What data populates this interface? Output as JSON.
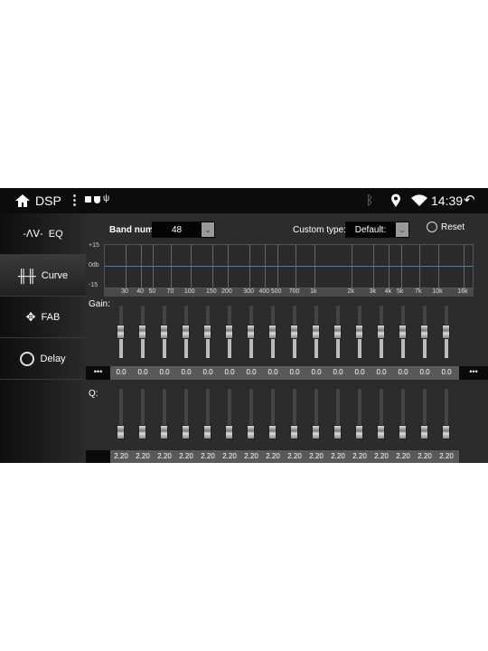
{
  "status_bar": {
    "title": "DSP",
    "time": "14:39",
    "icons": [
      "home-icon",
      "more-vert-icon",
      "image-icon",
      "shield-icon",
      "usb-icon",
      "bluetooth-icon",
      "location-icon",
      "wifi-icon",
      "back-icon"
    ]
  },
  "sidebar": {
    "items": [
      {
        "label": "EQ",
        "icon": "waveform-icon"
      },
      {
        "label": "Curve",
        "icon": "sliders-icon",
        "active": true
      },
      {
        "label": "FAB",
        "icon": "fader-balance-icon"
      },
      {
        "label": "Delay",
        "icon": "clock-icon"
      }
    ]
  },
  "controls": {
    "band_num_label": "Band num:",
    "band_num_value": "48",
    "custom_type_label": "Custom type:",
    "custom_type_value": "Default:",
    "reset_label": "Reset"
  },
  "graph": {
    "y_labels": [
      "+15",
      "0db",
      "-15"
    ],
    "freq_labels": [
      "30",
      "40",
      "50",
      "70",
      "100",
      "150",
      "200",
      "300",
      "400",
      "500",
      "700",
      "1k",
      "2k",
      "3k",
      "4k",
      "5k",
      "7k",
      "10k",
      "16k"
    ],
    "freq_hz": [
      30,
      40,
      50,
      70,
      100,
      150,
      200,
      300,
      400,
      500,
      700,
      1000,
      2000,
      3000,
      4000,
      5000,
      7000,
      10000,
      16000
    ],
    "curve_color": "#2f8fa8"
  },
  "gain": {
    "label": "Gain:",
    "range": [
      -15,
      15
    ],
    "values": [
      "0.0",
      "0.0",
      "0.0",
      "0.0",
      "0.0",
      "0.0",
      "0.0",
      "0.0",
      "0.0",
      "0.0",
      "0.0",
      "0.0",
      "0.0",
      "0.0",
      "0.0",
      "0.0"
    ],
    "more_left": "•••",
    "more_right": "•••"
  },
  "q": {
    "label": "Q:",
    "values": [
      "2.20",
      "2.20",
      "2.20",
      "2.20",
      "2.20",
      "2.20",
      "2.20",
      "2.20",
      "2.20",
      "2.20",
      "2.20",
      "2.20",
      "2.20",
      "2.20",
      "2.20",
      "2.20"
    ],
    "level": 0.15
  }
}
